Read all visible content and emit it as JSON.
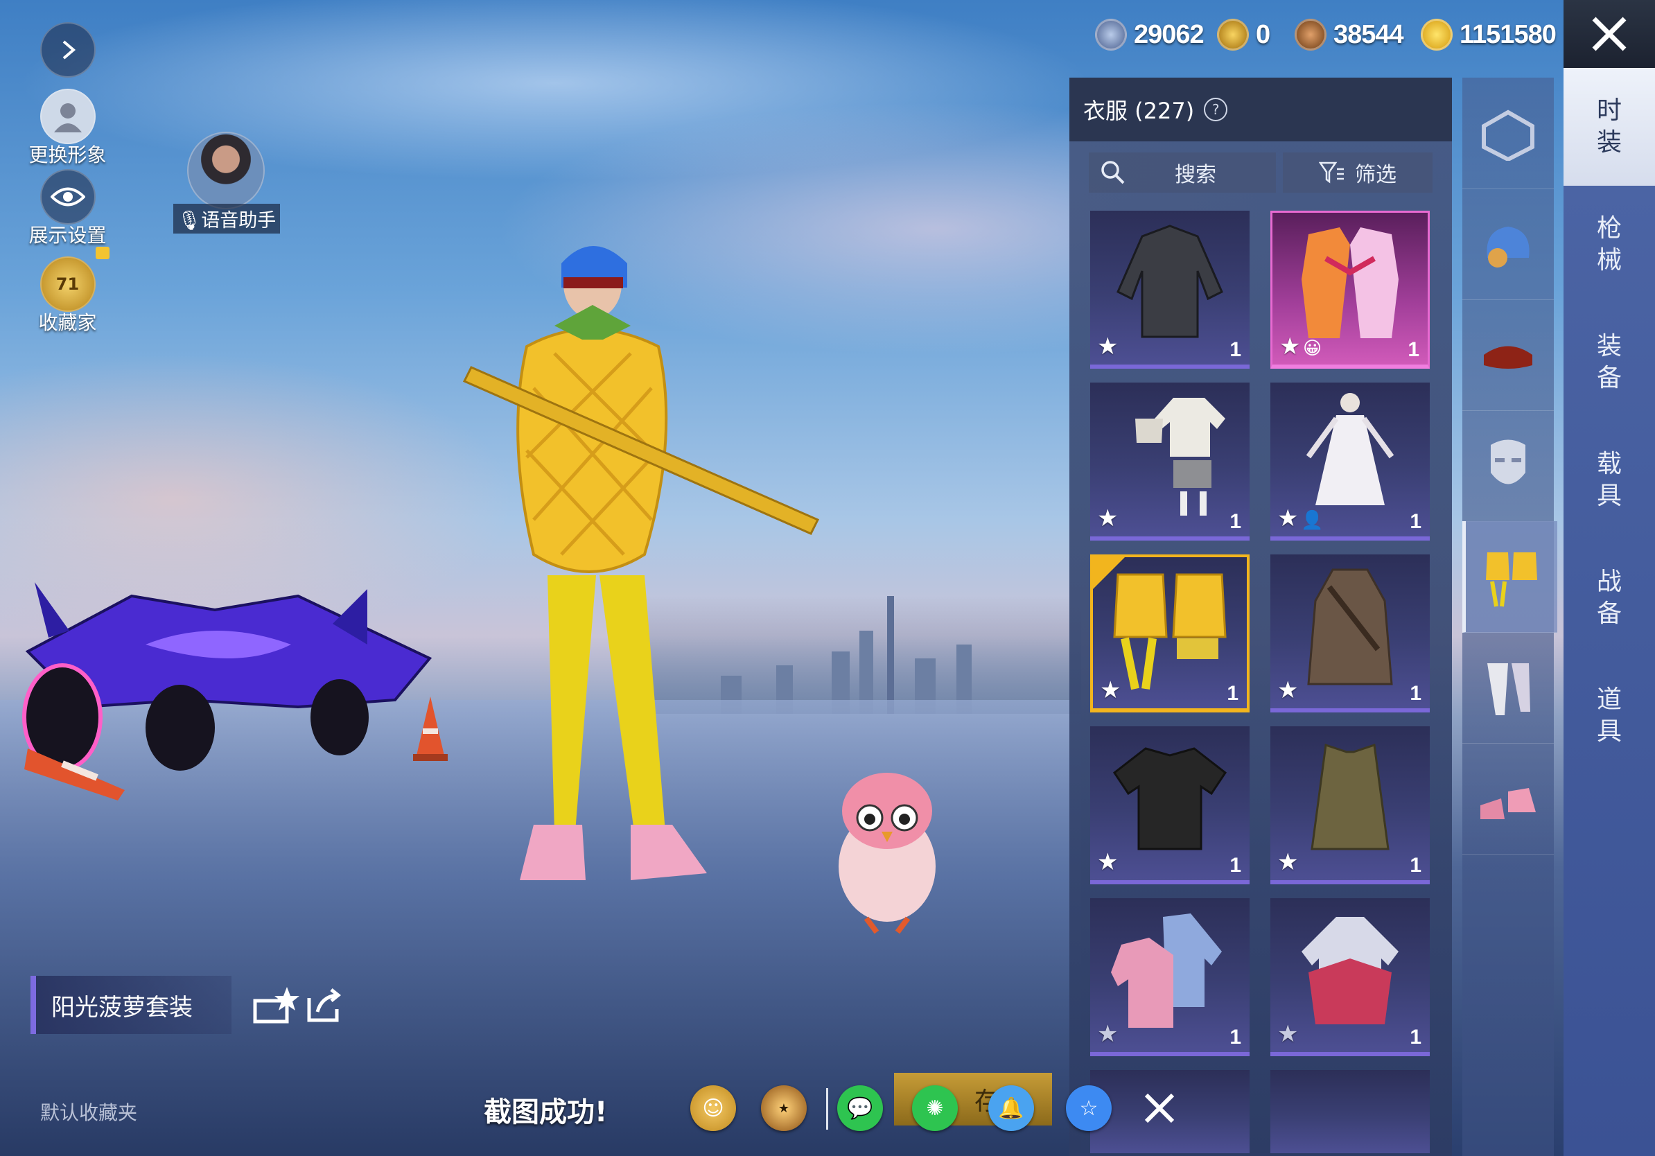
{
  "left_toolbar": {
    "change_avatar": "更换形象",
    "display_settings": "展示设置",
    "collector": "收藏家",
    "collector_level": "71",
    "voice_assistant": "语音助手"
  },
  "currencies": [
    {
      "icon": "silver-coin-icon",
      "value": "29062",
      "color": "#8fa9d6"
    },
    {
      "icon": "gold-token-icon",
      "value": "0",
      "color": "#e0a51c"
    },
    {
      "icon": "bronze-coin-icon",
      "value": "38544",
      "color": "#b8763a"
    },
    {
      "icon": "lightning-coin-icon",
      "value": "1151580",
      "color": "#f2c733"
    }
  ],
  "panel": {
    "title": "衣服 (227)",
    "search_label": "搜索",
    "filter_label": "筛选",
    "items": [
      {
        "name": "black-leather-jacket",
        "count": "1",
        "rarity": "normal"
      },
      {
        "name": "pink-floral-kimono-set",
        "count": "1",
        "rarity": "legendary"
      },
      {
        "name": "white-tee-shorts-set",
        "count": "1",
        "rarity": "normal"
      },
      {
        "name": "white-dress-outfit",
        "count": "1",
        "rarity": "normal"
      },
      {
        "name": "pineapple-suit",
        "count": "1",
        "rarity": "normal",
        "selected": true
      },
      {
        "name": "brown-trench-coat",
        "count": "1",
        "rarity": "normal"
      },
      {
        "name": "black-henley-shirt",
        "count": "1",
        "rarity": "normal"
      },
      {
        "name": "olive-vest",
        "count": "1",
        "rarity": "normal"
      },
      {
        "name": "pink-blue-jackets",
        "count": "1",
        "rarity": "normal"
      },
      {
        "name": "white-red-jacket-set",
        "count": "1",
        "rarity": "normal"
      }
    ]
  },
  "tabs": [
    "时装",
    "枪械",
    "装备",
    "载具",
    "战备",
    "道具"
  ],
  "categories": [
    "wardrobe-icon",
    "head-icon",
    "hat-icon",
    "face-mask-icon",
    "outfit-icon",
    "pants-icon",
    "shoes-icon"
  ],
  "bottom": {
    "outfit_name": "阳光菠萝套装",
    "favorites_folder": "默认收藏夹",
    "screenshot_msg": "截图成功!",
    "save_text": "存搭"
  },
  "colors": {
    "accent_purple": "#7d6be0",
    "selected_gold": "#f2b51e",
    "tab_blue": "#4d66a6"
  }
}
